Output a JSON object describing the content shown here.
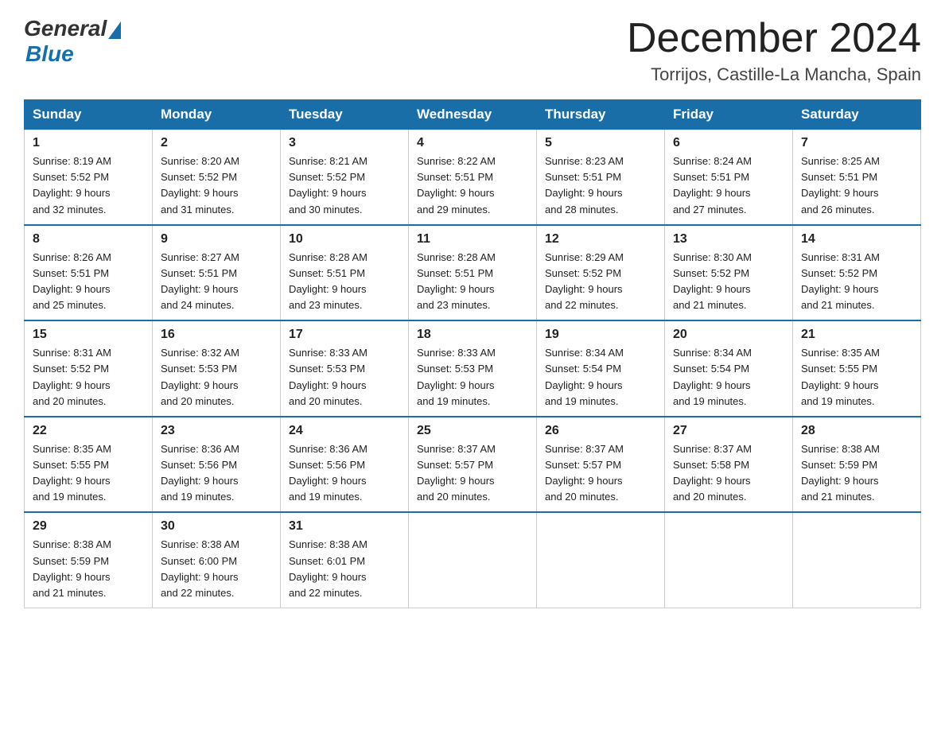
{
  "header": {
    "logo_general": "General",
    "logo_blue": "Blue",
    "month_year": "December 2024",
    "location": "Torrijos, Castille-La Mancha, Spain"
  },
  "days_of_week": [
    "Sunday",
    "Monday",
    "Tuesday",
    "Wednesday",
    "Thursday",
    "Friday",
    "Saturday"
  ],
  "weeks": [
    [
      {
        "day": "1",
        "sunrise": "8:19 AM",
        "sunset": "5:52 PM",
        "daylight": "9 hours and 32 minutes."
      },
      {
        "day": "2",
        "sunrise": "8:20 AM",
        "sunset": "5:52 PM",
        "daylight": "9 hours and 31 minutes."
      },
      {
        "day": "3",
        "sunrise": "8:21 AM",
        "sunset": "5:52 PM",
        "daylight": "9 hours and 30 minutes."
      },
      {
        "day": "4",
        "sunrise": "8:22 AM",
        "sunset": "5:51 PM",
        "daylight": "9 hours and 29 minutes."
      },
      {
        "day": "5",
        "sunrise": "8:23 AM",
        "sunset": "5:51 PM",
        "daylight": "9 hours and 28 minutes."
      },
      {
        "day": "6",
        "sunrise": "8:24 AM",
        "sunset": "5:51 PM",
        "daylight": "9 hours and 27 minutes."
      },
      {
        "day": "7",
        "sunrise": "8:25 AM",
        "sunset": "5:51 PM",
        "daylight": "9 hours and 26 minutes."
      }
    ],
    [
      {
        "day": "8",
        "sunrise": "8:26 AM",
        "sunset": "5:51 PM",
        "daylight": "9 hours and 25 minutes."
      },
      {
        "day": "9",
        "sunrise": "8:27 AM",
        "sunset": "5:51 PM",
        "daylight": "9 hours and 24 minutes."
      },
      {
        "day": "10",
        "sunrise": "8:28 AM",
        "sunset": "5:51 PM",
        "daylight": "9 hours and 23 minutes."
      },
      {
        "day": "11",
        "sunrise": "8:28 AM",
        "sunset": "5:51 PM",
        "daylight": "9 hours and 23 minutes."
      },
      {
        "day": "12",
        "sunrise": "8:29 AM",
        "sunset": "5:52 PM",
        "daylight": "9 hours and 22 minutes."
      },
      {
        "day": "13",
        "sunrise": "8:30 AM",
        "sunset": "5:52 PM",
        "daylight": "9 hours and 21 minutes."
      },
      {
        "day": "14",
        "sunrise": "8:31 AM",
        "sunset": "5:52 PM",
        "daylight": "9 hours and 21 minutes."
      }
    ],
    [
      {
        "day": "15",
        "sunrise": "8:31 AM",
        "sunset": "5:52 PM",
        "daylight": "9 hours and 20 minutes."
      },
      {
        "day": "16",
        "sunrise": "8:32 AM",
        "sunset": "5:53 PM",
        "daylight": "9 hours and 20 minutes."
      },
      {
        "day": "17",
        "sunrise": "8:33 AM",
        "sunset": "5:53 PM",
        "daylight": "9 hours and 20 minutes."
      },
      {
        "day": "18",
        "sunrise": "8:33 AM",
        "sunset": "5:53 PM",
        "daylight": "9 hours and 19 minutes."
      },
      {
        "day": "19",
        "sunrise": "8:34 AM",
        "sunset": "5:54 PM",
        "daylight": "9 hours and 19 minutes."
      },
      {
        "day": "20",
        "sunrise": "8:34 AM",
        "sunset": "5:54 PM",
        "daylight": "9 hours and 19 minutes."
      },
      {
        "day": "21",
        "sunrise": "8:35 AM",
        "sunset": "5:55 PM",
        "daylight": "9 hours and 19 minutes."
      }
    ],
    [
      {
        "day": "22",
        "sunrise": "8:35 AM",
        "sunset": "5:55 PM",
        "daylight": "9 hours and 19 minutes."
      },
      {
        "day": "23",
        "sunrise": "8:36 AM",
        "sunset": "5:56 PM",
        "daylight": "9 hours and 19 minutes."
      },
      {
        "day": "24",
        "sunrise": "8:36 AM",
        "sunset": "5:56 PM",
        "daylight": "9 hours and 19 minutes."
      },
      {
        "day": "25",
        "sunrise": "8:37 AM",
        "sunset": "5:57 PM",
        "daylight": "9 hours and 20 minutes."
      },
      {
        "day": "26",
        "sunrise": "8:37 AM",
        "sunset": "5:57 PM",
        "daylight": "9 hours and 20 minutes."
      },
      {
        "day": "27",
        "sunrise": "8:37 AM",
        "sunset": "5:58 PM",
        "daylight": "9 hours and 20 minutes."
      },
      {
        "day": "28",
        "sunrise": "8:38 AM",
        "sunset": "5:59 PM",
        "daylight": "9 hours and 21 minutes."
      }
    ],
    [
      {
        "day": "29",
        "sunrise": "8:38 AM",
        "sunset": "5:59 PM",
        "daylight": "9 hours and 21 minutes."
      },
      {
        "day": "30",
        "sunrise": "8:38 AM",
        "sunset": "6:00 PM",
        "daylight": "9 hours and 22 minutes."
      },
      {
        "day": "31",
        "sunrise": "8:38 AM",
        "sunset": "6:01 PM",
        "daylight": "9 hours and 22 minutes."
      },
      null,
      null,
      null,
      null
    ]
  ],
  "labels": {
    "sunrise": "Sunrise:",
    "sunset": "Sunset:",
    "daylight": "Daylight:"
  }
}
